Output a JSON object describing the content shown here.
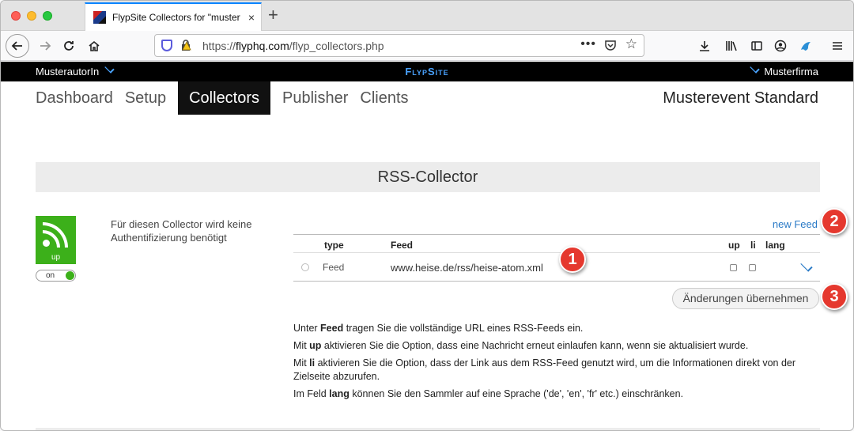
{
  "browser": {
    "tab_title": "FlypSite Collectors for \"musterf",
    "tab_close": "×",
    "new_tab": "+",
    "url_prefix": "https://",
    "url_host": "flyphq.com",
    "url_path": "/flyp_collectors.php",
    "url_more": "•••",
    "url_star": "☆"
  },
  "site_header": {
    "author": "MusterautorIn",
    "brand": "FlypSite",
    "company": "Musterfirma"
  },
  "main_nav": {
    "items": [
      "Dashboard",
      "Setup",
      "Collectors",
      "Publisher",
      "Clients"
    ],
    "active": "Collectors",
    "event": "Musterevent Standard"
  },
  "collector": {
    "section_title": "RSS-Collector",
    "icon_label": "up",
    "toggle_label": "on",
    "auth_text": "Für diesen Collector wird keine Authentifizierung benötigt",
    "new_feed_link": "new Feed",
    "columns": {
      "type": "type",
      "feed": "Feed",
      "up": "up",
      "li": "li",
      "lang": "lang"
    },
    "rows": [
      {
        "type": "Feed",
        "feed": "www.heise.de/rss/heise-atom.xml",
        "up": false,
        "li": false
      }
    ],
    "apply_button": "Änderungen übernehmen"
  },
  "help": {
    "line1_pre": "Unter ",
    "line1_bold": "Feed",
    "line1_post": " tragen Sie die vollständige URL eines RSS-Feeds ein.",
    "line2_pre": "Mit ",
    "line2_bold": "up",
    "line2_post": " aktivieren Sie die Option, dass eine Nachricht erneut einlaufen kann, wenn sie aktualisiert wurde.",
    "line3_pre": "Mit ",
    "line3_bold": "li",
    "line3_post": " aktivieren Sie die Option, dass der Link aus dem RSS-Feed genutzt wird, um die Informationen direkt von der Zielseite abzurufen.",
    "line4_pre": "Im Feld ",
    "line4_bold": "lang",
    "line4_post": " können Sie den Sammler auf eine Sprache ('de', 'en', 'fr' etc.) einschränken."
  },
  "annotations": [
    "1",
    "2",
    "3"
  ],
  "colors": {
    "accent_blue": "#2a7ac6",
    "brand_blue": "#4aa3ff",
    "rss_green": "#3cb01a",
    "badge_red": "#e5382e"
  }
}
